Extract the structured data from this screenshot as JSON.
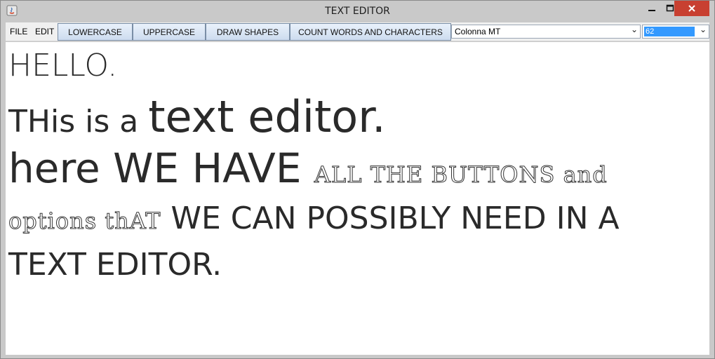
{
  "window": {
    "title": "TEXT EDITOR"
  },
  "menu": {
    "file": "FILE",
    "edit": "EDIT"
  },
  "toolbar": {
    "lowercase": "LOWERCASE",
    "uppercase": "UPPERCASE",
    "draw_shapes": "DRAW SHAPES",
    "count": "COUNT WORDS AND CHARACTERS"
  },
  "font_select": {
    "value": "Colonna MT"
  },
  "size_select": {
    "value": "62"
  },
  "editor": {
    "line1": "HELLO.",
    "line2_a": "THis is a ",
    "line2_b": "text editor.",
    "line3_a": "here WE HAVE ",
    "line3_b": "ALL THE BUTTONS and",
    "line4_a": "options thAT",
    "line4_b": " WE CAN POSSIBLY NEED IN A",
    "line5": "TEXT EDITOR."
  },
  "colors": {
    "close": "#c84031",
    "selection": "#3399ff"
  }
}
